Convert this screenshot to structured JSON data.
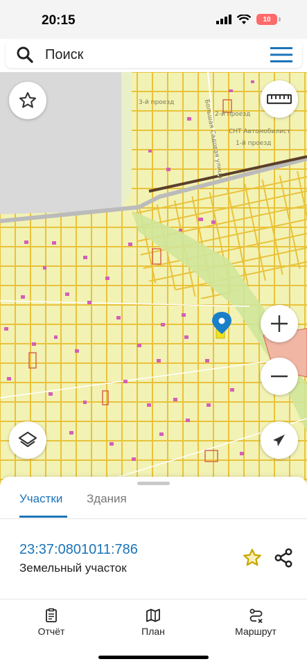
{
  "status_bar": {
    "time": "20:15",
    "battery": "10"
  },
  "search": {
    "placeholder": "Поиск"
  },
  "map": {
    "labels": {
      "prospect_3": "3-й проезд",
      "prospect_2": "2-й проезд",
      "prospect_1": "1-й проезд",
      "sadovaya": "Большая Садовая улица",
      "snt": "СНТ Автомобилист"
    }
  },
  "sheet": {
    "tabs": [
      {
        "label": "Участки",
        "active": true
      },
      {
        "label": "Здания",
        "active": false
      }
    ],
    "parcel": {
      "number": "23:37:0801011:786",
      "type": "Земельный участок"
    }
  },
  "bottom_nav": [
    {
      "label": "Отчёт",
      "icon": "report-icon"
    },
    {
      "label": "План",
      "icon": "map-plan-icon"
    },
    {
      "label": "Маршрут",
      "icon": "route-icon"
    }
  ],
  "colors": {
    "accent": "#1a73b8",
    "map_fill": "#f2f2b4",
    "parcel_border": "#e9c23a",
    "building": "#d35fb6",
    "rail": "#5a3f2a"
  }
}
